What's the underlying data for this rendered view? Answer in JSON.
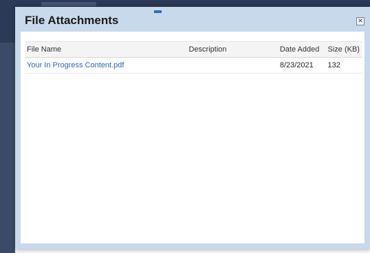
{
  "dialog": {
    "title": "File Attachments",
    "close_label": "✕"
  },
  "table": {
    "headers": {
      "file_name": "File Name",
      "description": "Description",
      "date_added": "Date Added",
      "size": "Size (KB)"
    },
    "rows": [
      {
        "file_name": "Your In Progress Content.pdf",
        "description": "",
        "date_added": "8/23/2021",
        "size": "132"
      }
    ]
  },
  "colors": {
    "dialog_frame": "#c9d9ec",
    "link": "#2a67b8",
    "background_header": "#2b3a57"
  }
}
